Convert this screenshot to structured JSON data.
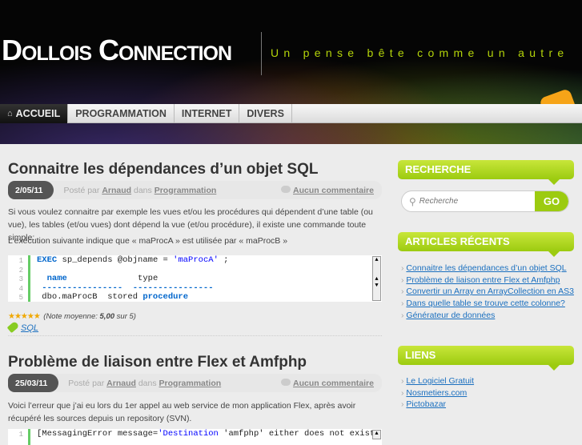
{
  "site": {
    "title": "Dollois Connection",
    "tagline": "Un pense bête comme un autre"
  },
  "nav": [
    {
      "label": "ACCUEIL",
      "icon": "home-icon"
    },
    {
      "label": "PROGRAMMATION"
    },
    {
      "label": "INTERNET"
    },
    {
      "label": "DIVERS"
    }
  ],
  "posts": [
    {
      "title": "Connaitre les dépendances d’un objet SQL",
      "date": "2/05/11",
      "posted_by": "Posté par",
      "author": "Arnaud",
      "in": "dans",
      "category": "Programmation",
      "comments": "Aucun commentaire",
      "p1": "Si vous voulez connaitre par exemple les vues et/ou les procédures qui dépendent d’une table (ou vue), les tables (et/ou vues) dont dépend la vue (et/ou procédure), il existe une commande toute simple:",
      "p2": "L’exécution suivante indique que « maProcA » est utilisée par « maProcB »",
      "code_line_numbers": "1\n2\n3\n4\n5",
      "code": {
        "l1_kw": "EXEC",
        "l1_mid": " sp_depends @objname = ",
        "l1_str": "'maProcA'",
        "l1_end": " ;",
        "l3_a": "name",
        "l3_b": "              type",
        "l4": " ----------------  ----------------",
        "l5_a": " dbo.maProcB  stored ",
        "l5_b": "procedure"
      },
      "stars": "★★★★★",
      "rating_pre": "(Note moyenne: ",
      "rating_value": "5,00",
      "rating_post": " sur 5)",
      "tag": "SQL"
    },
    {
      "title": "Problème de liaison entre Flex et Amfphp",
      "date": "25/03/11",
      "posted_by": "Posté par",
      "author": "Arnaud",
      "in": "dans",
      "category": "Programmation",
      "comments": "Aucun commentaire",
      "p1": "Voici l’erreur que j’ai eu lors du 1er appel au web service de mon application Flex, après avoir récupéré les sources depuis un repository (SVN).",
      "code_line_numbers": "1",
      "code": {
        "l1_a": "[MessagingError message=",
        "l1_str": "'Destination ",
        "l1_b": "'amfphp' either does not exist"
      }
    }
  ],
  "sidebar": {
    "search": {
      "title": "RECHERCHE",
      "placeholder": "Recherche",
      "button": "GO"
    },
    "recent": {
      "title": "ARTICLES RÉCENTS",
      "items": [
        "Connaitre les dépendances d’un objet SQL",
        "Problème de liaison entre Flex et Amfphp",
        "Convertir un Array en ArrayCollection en AS3",
        "Dans quelle table se trouve cette colonne?",
        "Générateur de données"
      ]
    },
    "links": {
      "title": "LIENS",
      "items": [
        "Le Logiciel Gratuit",
        "Nosmetiers.com",
        "Pictobazar"
      ]
    }
  }
}
